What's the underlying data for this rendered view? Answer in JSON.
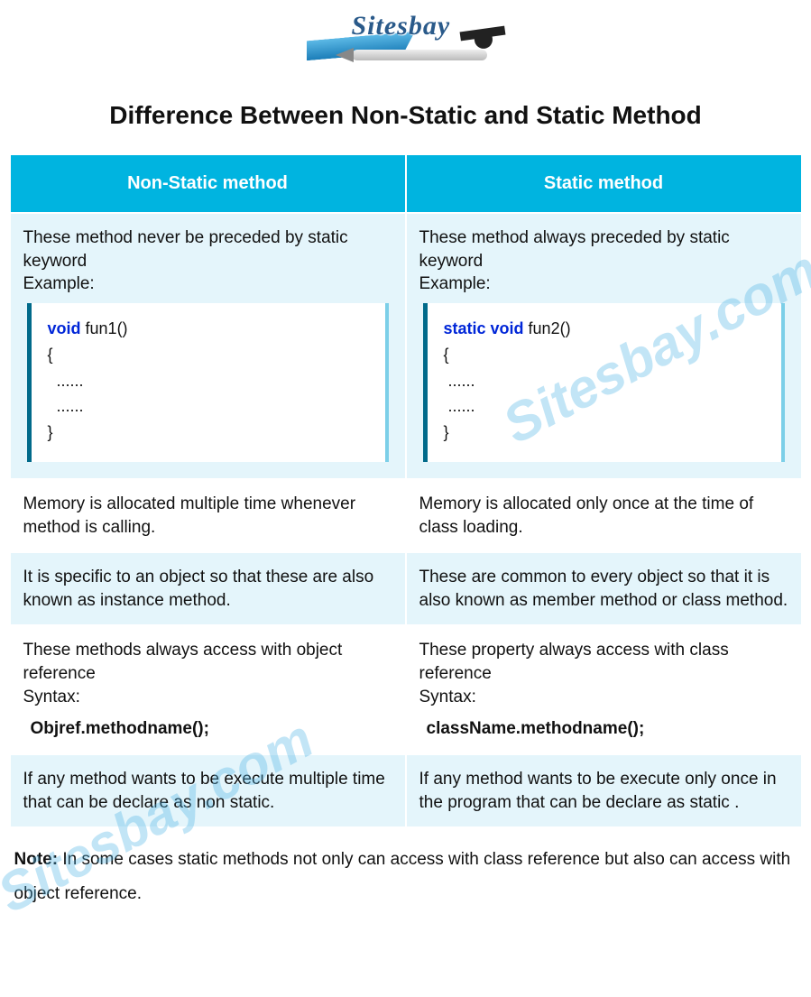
{
  "logo_text": "Sitesbay",
  "title": "Difference Between Non-Static and Static Method",
  "headers": {
    "left": "Non-Static method",
    "right": "Static method"
  },
  "rows": [
    {
      "left_text": "These method never be preceded by static keyword\nExample:",
      "right_text": "These method always preceded by static keyword\nExample:",
      "left_code": {
        "keywords": "void",
        "fn": "fun1()",
        "body": "{\n  ......\n  ......\n}"
      },
      "right_code": {
        "keywords": "static  void",
        "fn": "fun2()",
        "body": "{\n ......\n ......\n}"
      },
      "alt": true,
      "has_code": true
    },
    {
      "left_text": "Memory is allocated multiple time whenever method is calling.",
      "right_text": "Memory is allocated only once at the time of class loading.",
      "alt": false
    },
    {
      "left_text": "It is specific to an object so that these are also known as instance method.",
      "right_text": "These are common to every object so that it is also known as member method or class method.",
      "alt": true
    },
    {
      "left_text": "These methods always access with object reference\nSyntax:",
      "right_text": "These property always access with class reference\nSyntax:",
      "left_syntax": "Objref.methodname();",
      "right_syntax": "className.methodname();",
      "alt": false,
      "has_syntax": true
    },
    {
      "left_text": "If any method wants to be execute multiple time that can be declare as non static.",
      "right_text": "If any method wants to be execute only once in the program that can be declare as static .",
      "alt": true
    }
  ],
  "note_label": "Note:",
  "note_text": " In some cases static methods not only can access with class reference but also can access  with object reference.",
  "watermark": "Sitesbay.com"
}
